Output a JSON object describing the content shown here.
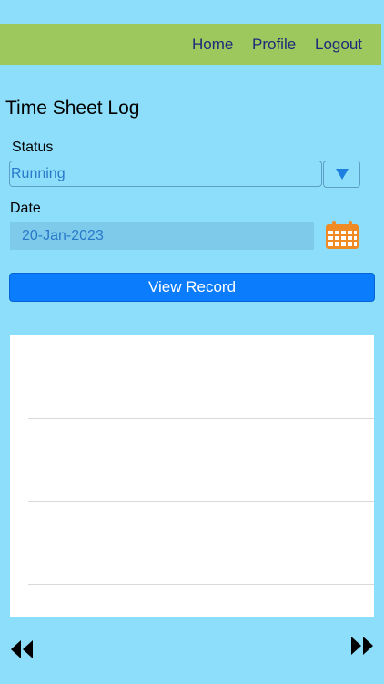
{
  "nav": {
    "home": "Home",
    "profile": "Profile",
    "logout": "Logout"
  },
  "page": {
    "title": "Time Sheet Log"
  },
  "status": {
    "label": "Status",
    "value": "Running"
  },
  "date": {
    "label": "Date",
    "value": "20-Jan-2023"
  },
  "actions": {
    "view_record": "View Record"
  },
  "icons": {
    "dropdown": "chevron-down-icon",
    "calendar": "calendar-icon",
    "previous": "rewind-icon",
    "next": "fast-forward-icon"
  },
  "colors": {
    "background": "#8ddefa",
    "nav_bar": "#9dc85e",
    "nav_text": "#1d2a7a",
    "primary_button": "#0b7cfb",
    "calendar_icon": "#f08a24"
  }
}
